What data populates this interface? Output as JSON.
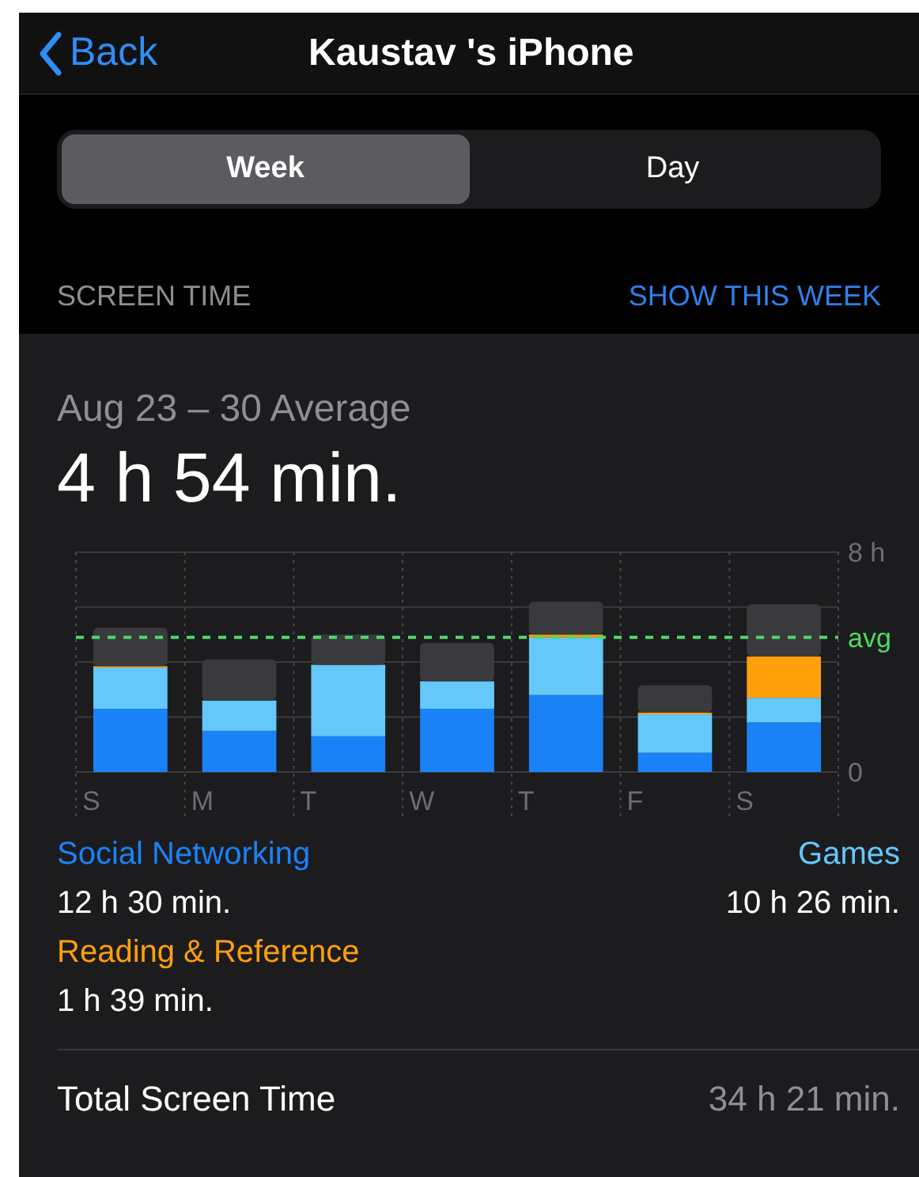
{
  "nav": {
    "back": "Back",
    "title": "Kaustav 's iPhone"
  },
  "segments": [
    {
      "label": "Week",
      "selected": true
    },
    {
      "label": "Day",
      "selected": false
    }
  ],
  "section": {
    "title": "SCREEN TIME",
    "action": "SHOW THIS WEEK"
  },
  "summary": {
    "range": "Aug 23 – 30 Average",
    "average": "4 h 54 min."
  },
  "chart_data": {
    "type": "bar",
    "stacked": true,
    "grid": true,
    "categories": [
      "S",
      "M",
      "T",
      "W",
      "T",
      "F",
      "S"
    ],
    "ylim": [
      0,
      8
    ],
    "yticks": [
      {
        "value": 0,
        "label": "0"
      },
      {
        "value": 8,
        "label": "8 h"
      }
    ],
    "series": [
      {
        "name": "Social Networking",
        "color": "#1a82f7",
        "values": [
          2.3,
          1.5,
          1.3,
          2.3,
          2.8,
          0.7,
          1.8
        ]
      },
      {
        "name": "Games",
        "color": "#64c8fa",
        "values": [
          1.5,
          1.1,
          2.6,
          1.0,
          2.1,
          1.4,
          0.9
        ]
      },
      {
        "name": "Reading & Reference",
        "color": "#ff9f0a",
        "values": [
          0.05,
          0,
          0,
          0,
          0.1,
          0.06,
          1.5
        ]
      },
      {
        "color": "#3a3a3c",
        "values": [
          1.4,
          1.5,
          1.1,
          1.4,
          1.2,
          1.0,
          1.9
        ]
      }
    ],
    "ref_lines": [
      {
        "axis": "y",
        "value": 4.9,
        "label": "avg",
        "color": "#4cd964"
      }
    ]
  },
  "legend": [
    {
      "time": "12 h 30 min."
    },
    {
      "time": "10 h 26 min."
    },
    {
      "time": "1 h 39 min."
    }
  ],
  "total": {
    "label": "Total Screen Time",
    "value": "34 h 21 min."
  }
}
